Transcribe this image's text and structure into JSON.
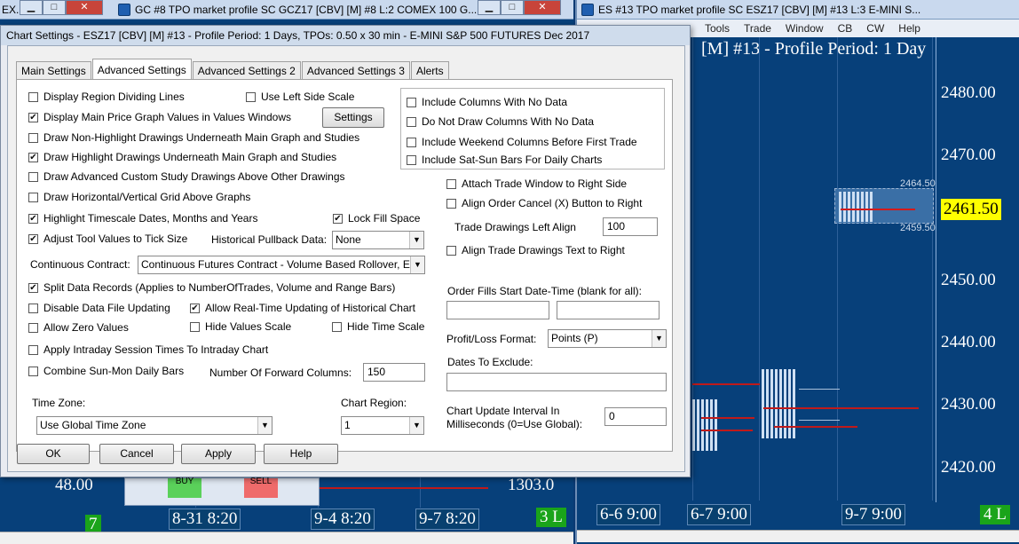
{
  "windows": {
    "left_partial": {
      "title": "EX...",
      "price": "48.00",
      "region_num": "7"
    },
    "gc": {
      "title": "GC #8 TPO market profile  SC GCZ17 [CBV] [M]  #8  L:2  COMEX 100 G...",
      "times": [
        "8-31  8:20",
        "9-4  8:20",
        "9-7  8:20"
      ],
      "price": "1303.0",
      "region": "3 L",
      "buy": "BUY",
      "sell": "SELL"
    },
    "es": {
      "title": "ES #13 TPO market profile  SC ESZ17 [CBV] [M]  #13  L:3  E-MINI S...",
      "menu": [
        "Tools",
        "Trade",
        "Window",
        "CB",
        "CW",
        "Help"
      ],
      "header_text": "[M]  #13 - Profile Period: 1 Day",
      "prices": [
        "2480.00",
        "2470.00",
        "2450.00",
        "2440.00",
        "2430.00",
        "2420.00"
      ],
      "current_price": "2461.50",
      "high_label": "2464.50",
      "low_label": "2459.50",
      "times": [
        "6-6  9:00",
        "6-7  9:00",
        "9-7  9:00"
      ],
      "region": "4 L"
    }
  },
  "dialog": {
    "title": "Chart Settings - ESZ17 [CBV] [M]  #13 - Profile Period: 1 Days, TPOs: 0.50 x 30 min   - E-MINI S&P 500 FUTURES Dec 2017",
    "tabs": [
      "Main Settings",
      "Advanced Settings",
      "Advanced Settings 2",
      "Advanced Settings 3",
      "Alerts"
    ],
    "checks": {
      "display_region_dividing": "Display Region Dividing Lines",
      "use_left_side_scale": "Use Left Side Scale",
      "display_main_price": "Display Main Price Graph Values in Values Windows",
      "draw_nonhighlight": "Draw Non-Highlight Drawings Underneath Main Graph and Studies",
      "draw_highlight": "Draw Highlight Drawings Underneath Main Graph and Studies",
      "draw_advanced_custom": "Draw Advanced Custom Study Drawings Above Other Drawings",
      "draw_grid_above": "Draw Horizontal/Vertical Grid Above Graphs",
      "highlight_timescale": "Highlight Timescale Dates, Months and Years",
      "lock_fill_space": "Lock Fill Space",
      "adjust_tool_values": "Adjust Tool Values to Tick Size",
      "split_data_records": "Split Data Records (Applies to NumberOfTrades, Volume and Range Bars)",
      "disable_data_file": "Disable Data File Updating",
      "allow_realtime": "Allow Real-Time Updating of Historical Chart",
      "allow_zero": "Allow Zero Values",
      "hide_values_scale": "Hide Values Scale",
      "hide_time_scale": "Hide Time Scale",
      "apply_intraday": "Apply Intraday Session Times To Intraday Chart",
      "combine_sun_mon": "Combine Sun-Mon Daily Bars",
      "include_no_data": "Include Columns With No Data",
      "do_not_draw_no_data": "Do Not Draw Columns With No Data",
      "include_weekend": "Include Weekend Columns Before First Trade",
      "include_sat_sun": "Include Sat-Sun Bars For Daily Charts",
      "attach_trade_window": "Attach Trade Window to Right Side",
      "align_order_cancel": "Align Order Cancel (X) Button to Right",
      "align_trade_text": "Align Trade Drawings Text to Right"
    },
    "checked_mark": "✔",
    "settings_button": "Settings",
    "historical_pullback_label": "Historical Pullback Data:",
    "historical_pullback_value": "None",
    "continuous_contract_label": "Continuous Contract:",
    "continuous_contract_value": "Continuous Futures Contract - Volume Based Rollover, E",
    "forward_columns_label": "Number Of Forward Columns:",
    "forward_columns_value": "150",
    "time_zone_label": "Time Zone:",
    "time_zone_value": "Use Global Time Zone",
    "chart_region_label": "Chart Region:",
    "chart_region_value": "1",
    "trade_drawings_left_label": "Trade Drawings Left Align",
    "trade_drawings_left_value": "100",
    "order_fills_label": "Order Fills Start Date-Time (blank for all):",
    "profit_loss_label": "Profit/Loss Format:",
    "profit_loss_value": "Points (P)",
    "dates_exclude_label": "Dates To Exclude:",
    "update_interval_label_1": "Chart Update Interval In",
    "update_interval_label_2": "Milliseconds (0=Use Global):",
    "update_interval_value": "0",
    "buttons": {
      "ok": "OK",
      "cancel": "Cancel",
      "apply": "Apply",
      "help": "Help"
    }
  }
}
